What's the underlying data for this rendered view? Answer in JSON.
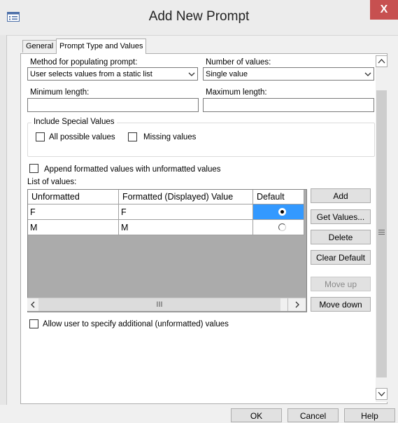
{
  "window": {
    "title": "Add New Prompt",
    "close_label": "X"
  },
  "tabs": [
    {
      "label": "General",
      "active": false
    },
    {
      "label": "Prompt Type and Values",
      "active": true
    }
  ],
  "method": {
    "label": "Method for populating prompt:",
    "value": "User selects values from a static list"
  },
  "num_values": {
    "label": "Number of values:",
    "value": "Single value"
  },
  "min_length": {
    "label": "Minimum length:",
    "value": ""
  },
  "max_length": {
    "label": "Maximum length:",
    "value": ""
  },
  "special": {
    "title": "Include Special Values",
    "all_possible": {
      "label": "All possible values",
      "checked": false
    },
    "missing": {
      "label": "Missing values",
      "checked": false
    }
  },
  "append_formatted": {
    "label": "Append formatted values with unformatted values",
    "checked": false
  },
  "list_label": "List of values:",
  "table": {
    "headers": [
      "Unformatted",
      "Formatted (Displayed) Value",
      "Default"
    ],
    "rows": [
      {
        "unformatted": "F",
        "formatted": "F",
        "default": true
      },
      {
        "unformatted": "M",
        "formatted": "M",
        "default": false
      }
    ],
    "hscroll_thumb": "III"
  },
  "side_buttons": {
    "add": "Add",
    "get_values": "Get Values...",
    "delete": "Delete",
    "clear_default": "Clear Default",
    "move_up": "Move up",
    "move_down": "Move down"
  },
  "allow_additional": {
    "label": "Allow user to specify additional (unformatted) values",
    "checked": false
  },
  "footer": {
    "ok": "OK",
    "cancel": "Cancel",
    "help": "Help"
  },
  "colors": {
    "selection": "#3399ff",
    "close": "#c75050"
  }
}
